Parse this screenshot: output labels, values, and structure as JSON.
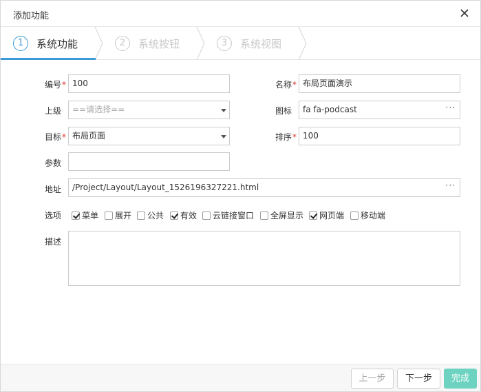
{
  "dialog": {
    "title": "添加功能",
    "close_icon": "close-icon"
  },
  "steps": [
    {
      "num": "1",
      "label": "系统功能",
      "active": true
    },
    {
      "num": "2",
      "label": "系统按钮",
      "active": false
    },
    {
      "num": "3",
      "label": "系统视图",
      "active": false
    }
  ],
  "form": {
    "code": {
      "label": "编号",
      "value": "100"
    },
    "name": {
      "label": "名称",
      "value": "布局页面演示"
    },
    "parent": {
      "label": "上级",
      "placeholder": "==请选择=="
    },
    "icon": {
      "label": "图标",
      "value": "fa fa-podcast"
    },
    "target": {
      "label": "目标",
      "value": "布局页面"
    },
    "order": {
      "label": "排序",
      "value": "100"
    },
    "params": {
      "label": "参数",
      "value": ""
    },
    "address": {
      "label": "地址",
      "value": "/Project/Layout/Layout_1526196327221.html"
    },
    "options": {
      "label": "选项",
      "items": [
        {
          "label": "菜单",
          "checked": true
        },
        {
          "label": "展开",
          "checked": false
        },
        {
          "label": "公共",
          "checked": false
        },
        {
          "label": "有效",
          "checked": true
        },
        {
          "label": "云链接窗口",
          "checked": false
        },
        {
          "label": "全屏显示",
          "checked": false
        },
        {
          "label": "网页端",
          "checked": true
        },
        {
          "label": "移动端",
          "checked": false
        }
      ]
    },
    "description": {
      "label": "描述",
      "value": ""
    },
    "required_mark": "*",
    "more_glyph": "···"
  },
  "footer": {
    "prev": "上一步",
    "next": "下一步",
    "finish": "完成"
  },
  "colors": {
    "accent": "#3d9ad8",
    "finish_button": "#6dd3c0",
    "required": "#d9322a"
  }
}
